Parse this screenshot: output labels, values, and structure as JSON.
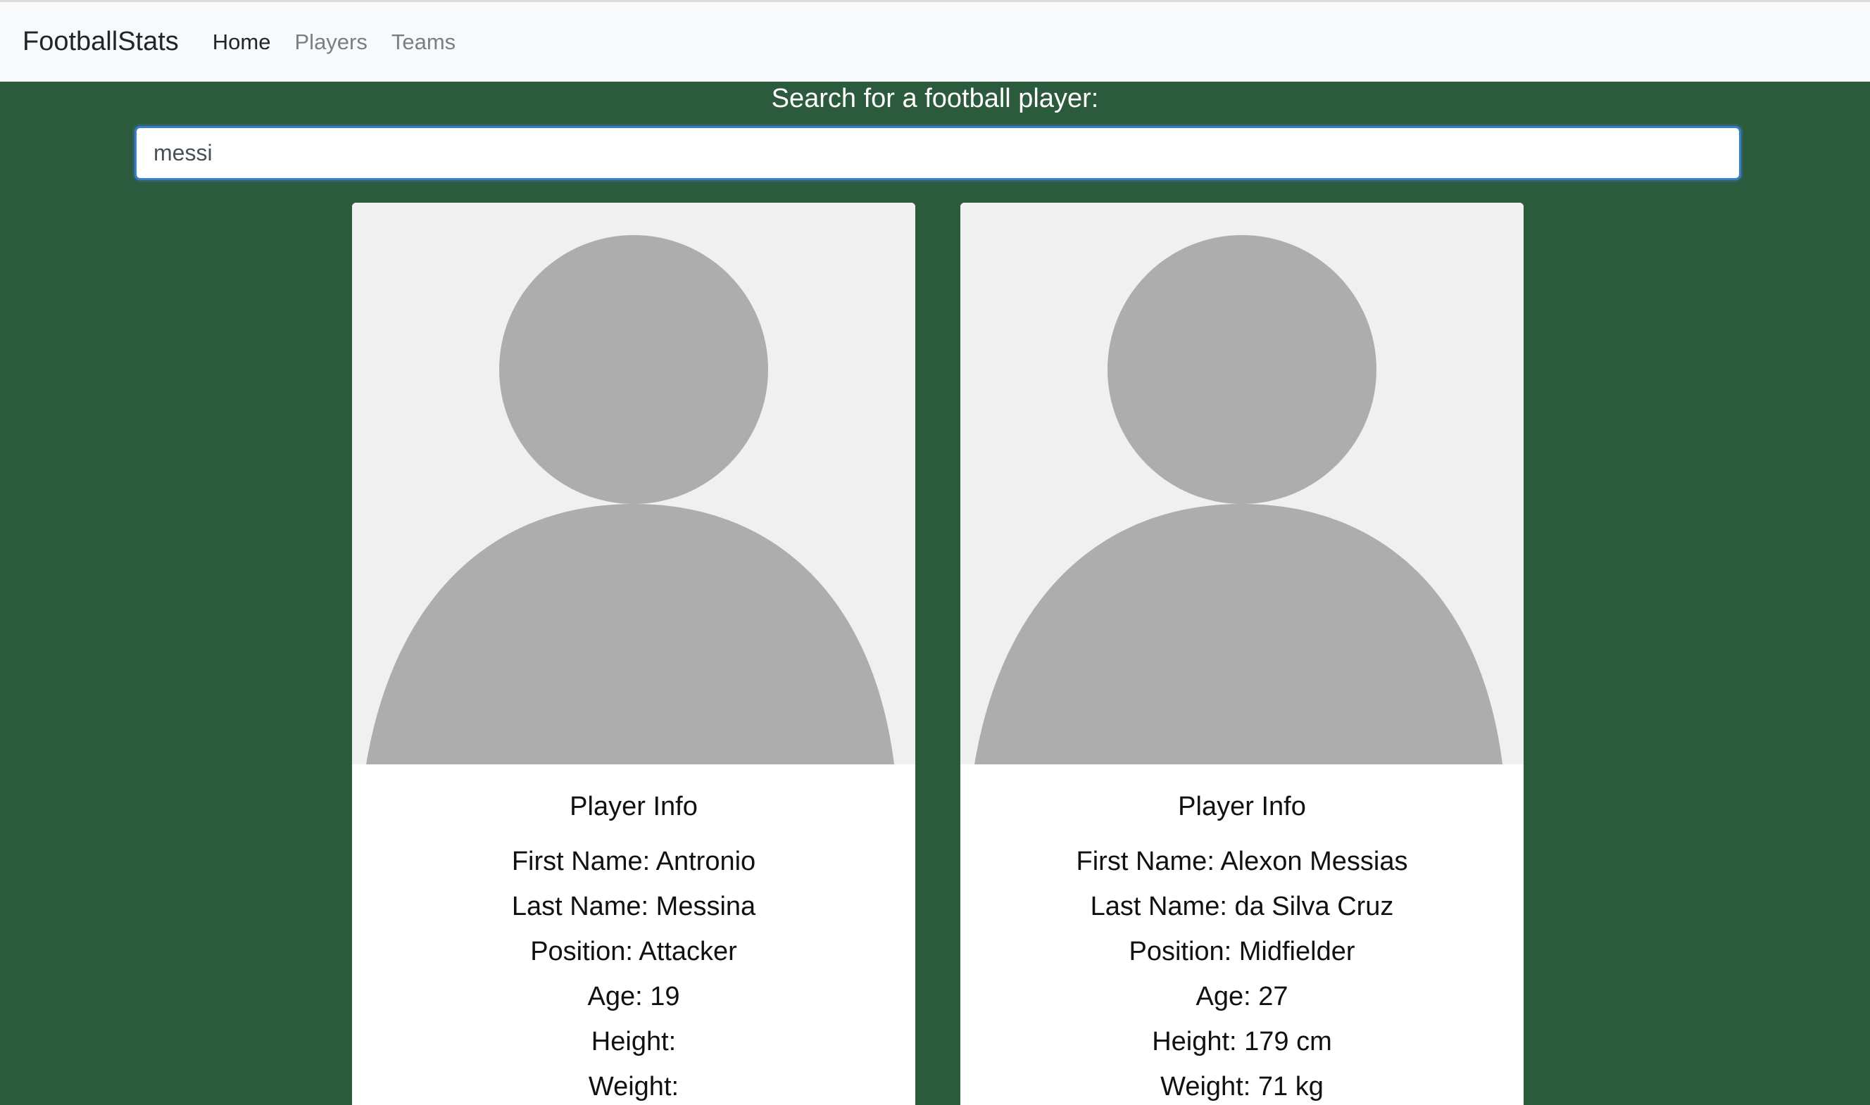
{
  "navbar": {
    "brand": "FootballStats",
    "links": [
      {
        "label": "Home",
        "active": true
      },
      {
        "label": "Players",
        "active": false
      },
      {
        "label": "Teams",
        "active": false
      }
    ]
  },
  "search": {
    "label": "Search for a football player:",
    "value": "messi"
  },
  "colors": {
    "background": "#2c5a3d",
    "avatar_bg": "#f0f0f0",
    "avatar_fill": "#adadad"
  },
  "players": [
    {
      "title": "Player Info",
      "first_name": "First Name: Antronio",
      "last_name": "Last Name: Messina",
      "position": "Position: Attacker",
      "age": "Age: 19",
      "height": "Height:",
      "weight": "Weight:"
    },
    {
      "title": "Player Info",
      "first_name": "First Name: Alexon Messias",
      "last_name": "Last Name: da Silva Cruz",
      "position": "Position: Midfielder",
      "age": "Age: 27",
      "height": "Height: 179 cm",
      "weight": "Weight: 71 kg"
    }
  ]
}
